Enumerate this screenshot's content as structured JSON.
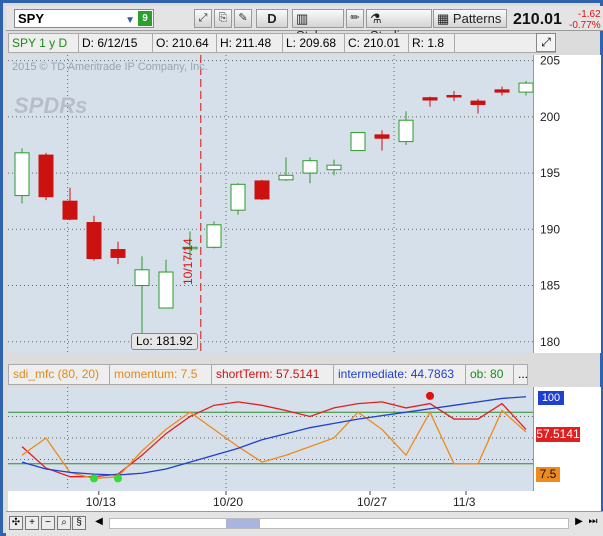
{
  "toolbar": {
    "symbol": "SPY",
    "symbol_count": "9",
    "timeframe_button": "D",
    "style_label": "Style",
    "studies_label": "Studies",
    "patterns_label": "Patterns",
    "last_price": "210.01",
    "net_change": "-1.62",
    "pct_change": "-0.77%"
  },
  "info_bar": {
    "symbol_period": "SPY 1 y D",
    "date": "D: 6/12/15",
    "open": "O: 210.64",
    "high": "H: 211.48",
    "low": "L: 209.68",
    "close": "C: 210.01",
    "range": "R: 1.8"
  },
  "watermark": {
    "copyright": "2015 © TD Ameritrade IP Company, Inc.",
    "logo_text": "SPDRs"
  },
  "annotations": {
    "low_label": "Lo: 181.92",
    "vline_label": "10/17/14"
  },
  "lower_header": {
    "study_name": "sdi_mfc (80, 20)",
    "momentum": "momentum: 7.5",
    "short_term": "shortTerm: 57.5141",
    "intermediate": "intermediate: 44.7863",
    "ob": "ob: 80",
    "more": "..."
  },
  "colors": {
    "up_candle": "#2b9a2b",
    "down_candle": "#cc1111",
    "short_term": "#e02020",
    "momentum": "#ef8a1f",
    "intermediate": "#1f3fd1",
    "level_line": "#2e8b2e"
  },
  "chart_data": [
    {
      "type": "candlestick",
      "y_ticks": [
        180,
        185,
        190,
        195,
        200,
        205
      ],
      "ylim": [
        179,
        205.5
      ],
      "x_ticks": [
        "10/13",
        "10/20",
        "10/27",
        "11/3"
      ],
      "candles": [
        {
          "o": 193,
          "h": 197.2,
          "l": 192.3,
          "c": 196.8
        },
        {
          "o": 196.6,
          "h": 196.8,
          "l": 192.6,
          "c": 192.9
        },
        {
          "o": 192.5,
          "h": 193.7,
          "l": 190.8,
          "c": 190.9
        },
        {
          "o": 190.6,
          "h": 191.2,
          "l": 187.2,
          "c": 187.4
        },
        {
          "o": 188.2,
          "h": 188.9,
          "l": 186.9,
          "c": 187.5
        },
        {
          "o": 185,
          "h": 187.6,
          "l": 181.92,
          "c": 186.4
        },
        {
          "o": 183,
          "h": 187.3,
          "l": 183,
          "c": 186.2
        },
        {
          "o": 188.3,
          "h": 189.8,
          "l": 187.3,
          "c": 188.4
        },
        {
          "o": 188.4,
          "h": 190.7,
          "l": 188.3,
          "c": 190.4
        },
        {
          "o": 191.7,
          "h": 194.1,
          "l": 191.3,
          "c": 194
        },
        {
          "o": 194.3,
          "h": 194.4,
          "l": 192.6,
          "c": 192.7
        },
        {
          "o": 194.4,
          "h": 196.4,
          "l": 194.3,
          "c": 194.8
        },
        {
          "o": 195,
          "h": 196.4,
          "l": 194.1,
          "c": 196.1
        },
        {
          "o": 195.3,
          "h": 196.2,
          "l": 194.8,
          "c": 195.7
        },
        {
          "o": 197,
          "h": 198.6,
          "l": 197,
          "c": 198.6
        },
        {
          "o": 198.4,
          "h": 198.8,
          "l": 197,
          "c": 198.1
        },
        {
          "o": 197.8,
          "h": 200.5,
          "l": 197.5,
          "c": 199.7
        },
        {
          "o": 201.7,
          "h": 201.8,
          "l": 200.9,
          "c": 201.5
        },
        {
          "o": 201.9,
          "h": 202.3,
          "l": 201.4,
          "c": 201.8
        },
        {
          "o": 201.4,
          "h": 201.6,
          "l": 200.3,
          "c": 201.1
        },
        {
          "o": 202.4,
          "h": 202.7,
          "l": 201.9,
          "c": 202.2
        },
        {
          "o": 202.2,
          "h": 203.2,
          "l": 201.9,
          "c": 203
        }
      ]
    },
    {
      "type": "line",
      "y_labels": [
        "100",
        "57.5141",
        "7.5"
      ],
      "ylim": [
        0,
        100
      ],
      "levels": [
        80,
        20
      ],
      "series": [
        {
          "name": "shortTerm",
          "values": [
            40,
            15,
            5,
            5,
            8,
            30,
            55,
            75,
            88,
            92,
            88,
            82,
            75,
            85,
            90,
            92,
            85,
            90,
            72,
            72,
            90,
            60
          ]
        },
        {
          "name": "momentum",
          "values": [
            30,
            50,
            10,
            3,
            5,
            35,
            60,
            80,
            60,
            40,
            22,
            30,
            40,
            50,
            80,
            60,
            30,
            80,
            20,
            20,
            82,
            57
          ]
        },
        {
          "name": "intermediate",
          "values": [
            22,
            14,
            10,
            8,
            7,
            9,
            14,
            22,
            30,
            38,
            48,
            55,
            62,
            67,
            72,
            76,
            80,
            84,
            88,
            92,
            96,
            98
          ]
        }
      ],
      "markers": [
        {
          "series": "momentum",
          "index": 3,
          "value": 3
        },
        {
          "series": "momentum",
          "index": 4,
          "value": 3
        },
        {
          "series": "shortTerm",
          "index": 17,
          "value": 99
        }
      ]
    }
  ]
}
